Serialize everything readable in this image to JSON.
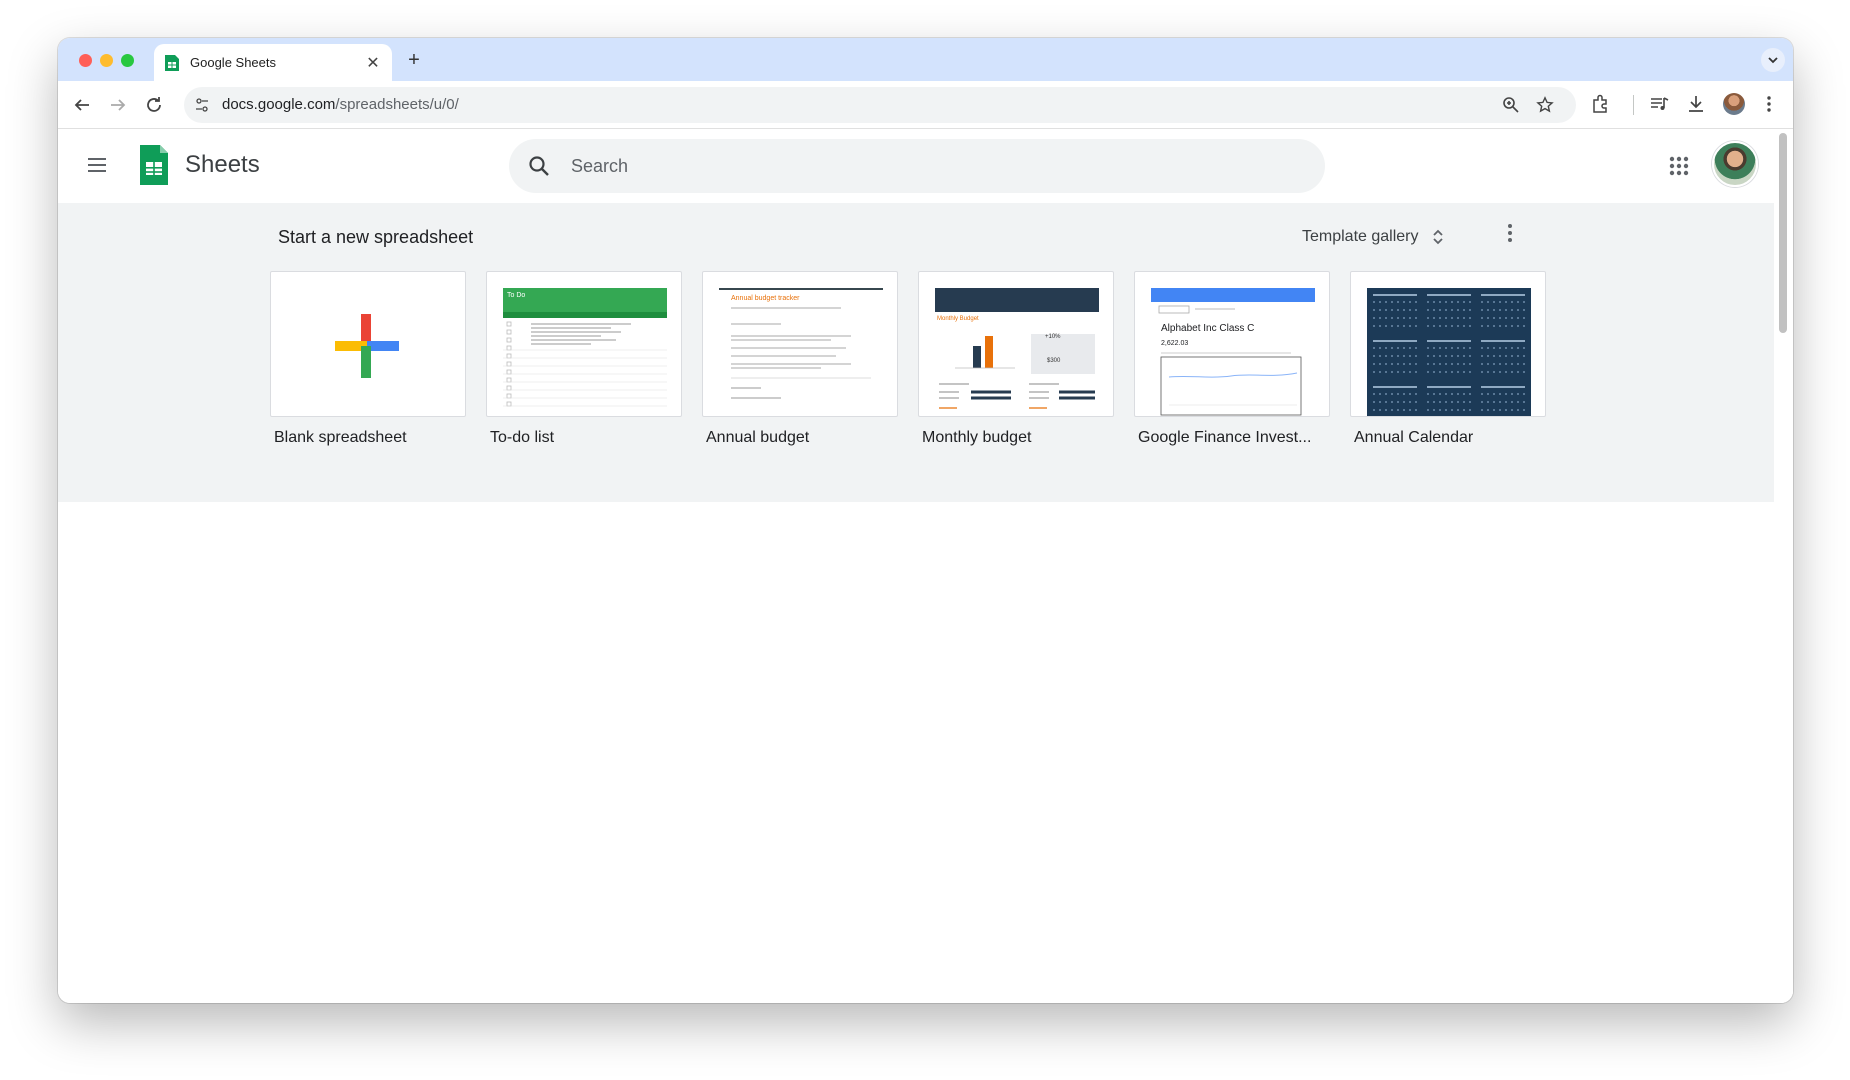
{
  "browser": {
    "tab_title": "Google Sheets",
    "url_host": "docs.google.com",
    "url_path": "/spreadsheets/u/0/"
  },
  "app": {
    "name": "Sheets",
    "search_placeholder": "Search"
  },
  "templates": {
    "section_title": "Start a new spreadsheet",
    "gallery_label": "Template gallery",
    "items": [
      {
        "label": "Blank spreadsheet"
      },
      {
        "label": "To-do list",
        "thumb_heading": "To Do"
      },
      {
        "label": "Annual budget",
        "thumb_heading": "Annual budget tracker"
      },
      {
        "label": "Monthly budget",
        "thumb_heading": "Monthly Budget",
        "thumb_amount": "$300",
        "thumb_pct": "+10%"
      },
      {
        "label": "Google Finance Invest...",
        "thumb_heading": "Alphabet Inc Class C",
        "thumb_value": "2,622.03"
      },
      {
        "label": "Annual Calendar"
      }
    ]
  },
  "colors": {
    "sheets_green": "#0f9d58",
    "tab_strip": "#d3e3fd",
    "band_bg": "#f1f3f4",
    "calendar_navy": "#1c3a57"
  }
}
